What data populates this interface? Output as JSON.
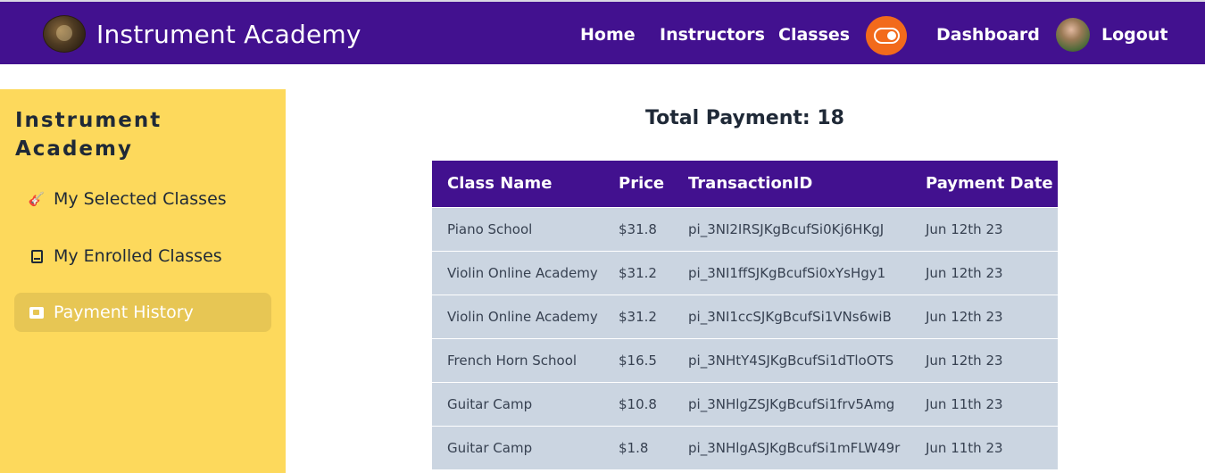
{
  "navbar": {
    "brand_name": "Instrument Academy",
    "links": {
      "home": "Home",
      "instructors": "Instructors",
      "classes": "Classes",
      "dashboard": "Dashboard",
      "logout": "Logout"
    },
    "theme_toggle_color": "#f26a1b",
    "background": "#42118f"
  },
  "sidebar": {
    "title": "Instrument Academy",
    "items": [
      {
        "label": "My Selected Classes",
        "icon": "guitar-icon",
        "active": false
      },
      {
        "label": "My Enrolled Classes",
        "icon": "book-icon",
        "active": false
      },
      {
        "label": "Payment History",
        "icon": "payment-icon",
        "active": true
      }
    ],
    "background": "#fdd95c"
  },
  "main": {
    "total_label": "Total Payment: 18",
    "table": {
      "columns": [
        "Class Name",
        "Price",
        "TransactionID",
        "Payment Date"
      ],
      "rows": [
        [
          "Piano School",
          "$31.8",
          "pi_3NI2IRSJKgBcufSi0Kj6HKgJ",
          "Jun 12th 23"
        ],
        [
          "Violin Online Academy",
          "$31.2",
          "pi_3NI1ffSJKgBcufSi0xYsHgy1",
          "Jun 12th 23"
        ],
        [
          "Violin Online Academy",
          "$31.2",
          "pi_3NI1ccSJKgBcufSi1VNs6wiB",
          "Jun 12th 23"
        ],
        [
          "French Horn School",
          "$16.5",
          "pi_3NHtY4SJKgBcufSi1dTloOTS",
          "Jun 12th 23"
        ],
        [
          "Guitar Camp",
          "$10.8",
          "pi_3NHlgZSJKgBcufSi1frv5Amg",
          "Jun 11th 23"
        ],
        [
          "Guitar Camp",
          "$1.8",
          "pi_3NHlgASJKgBcufSi1mFLW49r",
          "Jun 11th 23"
        ]
      ]
    }
  }
}
